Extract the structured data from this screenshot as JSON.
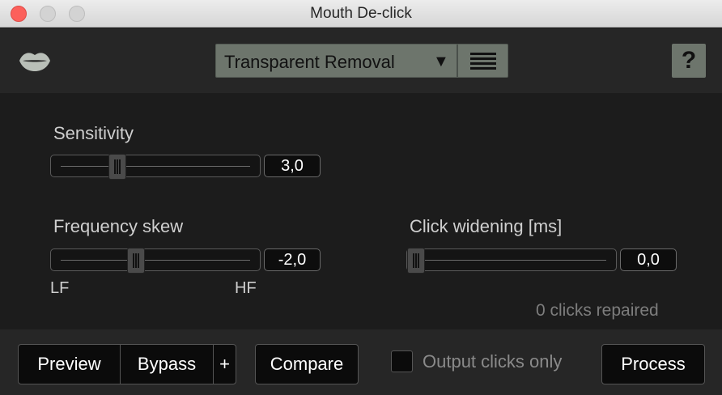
{
  "window": {
    "title": "Mouth De-click"
  },
  "header": {
    "logo_icon": "lips-icon",
    "preset": {
      "selected": "Transparent Removal",
      "arrow": "▼"
    },
    "help_label": "?"
  },
  "controls": {
    "sensitivity": {
      "label": "Sensitivity",
      "value": "3,0",
      "level": 0.3
    },
    "frequency_skew": {
      "label": "Frequency skew",
      "value": "-2,0",
      "level": 0.4,
      "left_label": "LF",
      "right_label": "HF"
    },
    "click_widening": {
      "label": "Click widening [ms]",
      "value": "0,0",
      "level": 0.0
    },
    "status": "0 clicks repaired"
  },
  "footer": {
    "preview_label": "Preview",
    "bypass_label": "Bypass",
    "plus_label": "+",
    "compare_label": "Compare",
    "output_clicks_label": "Output clicks only",
    "output_clicks_checked": false,
    "process_label": "Process"
  }
}
